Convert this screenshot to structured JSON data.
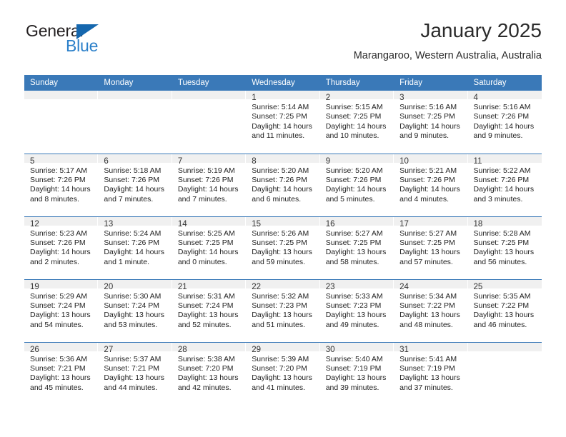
{
  "brand": {
    "name_top": "General",
    "name_bottom": "Blue",
    "accent_color": "#1567ae",
    "text_color": "#231f20"
  },
  "header": {
    "title": "January 2025",
    "location": "Marangaroo, Western Australia, Australia",
    "header_bg_color": "#3a79b8",
    "daynum_bg_color": "#f0f0f0"
  },
  "weekday_headers": [
    "Sunday",
    "Monday",
    "Tuesday",
    "Wednesday",
    "Thursday",
    "Friday",
    "Saturday"
  ],
  "labels": {
    "sunrise": "Sunrise:",
    "sunset": "Sunset:",
    "daylight": "Daylight:"
  },
  "weeks": [
    [
      {
        "day": "",
        "empty": true
      },
      {
        "day": "",
        "empty": true
      },
      {
        "day": "",
        "empty": true
      },
      {
        "day": "1",
        "sunrise": "Sunrise: 5:14 AM",
        "sunset": "Sunset: 7:25 PM",
        "daylight_line1": "Daylight: 14 hours",
        "daylight_line2": "and 11 minutes."
      },
      {
        "day": "2",
        "sunrise": "Sunrise: 5:15 AM",
        "sunset": "Sunset: 7:25 PM",
        "daylight_line1": "Daylight: 14 hours",
        "daylight_line2": "and 10 minutes."
      },
      {
        "day": "3",
        "sunrise": "Sunrise: 5:16 AM",
        "sunset": "Sunset: 7:25 PM",
        "daylight_line1": "Daylight: 14 hours",
        "daylight_line2": "and 9 minutes."
      },
      {
        "day": "4",
        "sunrise": "Sunrise: 5:16 AM",
        "sunset": "Sunset: 7:26 PM",
        "daylight_line1": "Daylight: 14 hours",
        "daylight_line2": "and 9 minutes."
      }
    ],
    [
      {
        "day": "5",
        "sunrise": "Sunrise: 5:17 AM",
        "sunset": "Sunset: 7:26 PM",
        "daylight_line1": "Daylight: 14 hours",
        "daylight_line2": "and 8 minutes."
      },
      {
        "day": "6",
        "sunrise": "Sunrise: 5:18 AM",
        "sunset": "Sunset: 7:26 PM",
        "daylight_line1": "Daylight: 14 hours",
        "daylight_line2": "and 7 minutes."
      },
      {
        "day": "7",
        "sunrise": "Sunrise: 5:19 AM",
        "sunset": "Sunset: 7:26 PM",
        "daylight_line1": "Daylight: 14 hours",
        "daylight_line2": "and 7 minutes."
      },
      {
        "day": "8",
        "sunrise": "Sunrise: 5:20 AM",
        "sunset": "Sunset: 7:26 PM",
        "daylight_line1": "Daylight: 14 hours",
        "daylight_line2": "and 6 minutes."
      },
      {
        "day": "9",
        "sunrise": "Sunrise: 5:20 AM",
        "sunset": "Sunset: 7:26 PM",
        "daylight_line1": "Daylight: 14 hours",
        "daylight_line2": "and 5 minutes."
      },
      {
        "day": "10",
        "sunrise": "Sunrise: 5:21 AM",
        "sunset": "Sunset: 7:26 PM",
        "daylight_line1": "Daylight: 14 hours",
        "daylight_line2": "and 4 minutes."
      },
      {
        "day": "11",
        "sunrise": "Sunrise: 5:22 AM",
        "sunset": "Sunset: 7:26 PM",
        "daylight_line1": "Daylight: 14 hours",
        "daylight_line2": "and 3 minutes."
      }
    ],
    [
      {
        "day": "12",
        "sunrise": "Sunrise: 5:23 AM",
        "sunset": "Sunset: 7:26 PM",
        "daylight_line1": "Daylight: 14 hours",
        "daylight_line2": "and 2 minutes."
      },
      {
        "day": "13",
        "sunrise": "Sunrise: 5:24 AM",
        "sunset": "Sunset: 7:26 PM",
        "daylight_line1": "Daylight: 14 hours",
        "daylight_line2": "and 1 minute."
      },
      {
        "day": "14",
        "sunrise": "Sunrise: 5:25 AM",
        "sunset": "Sunset: 7:25 PM",
        "daylight_line1": "Daylight: 14 hours",
        "daylight_line2": "and 0 minutes."
      },
      {
        "day": "15",
        "sunrise": "Sunrise: 5:26 AM",
        "sunset": "Sunset: 7:25 PM",
        "daylight_line1": "Daylight: 13 hours",
        "daylight_line2": "and 59 minutes."
      },
      {
        "day": "16",
        "sunrise": "Sunrise: 5:27 AM",
        "sunset": "Sunset: 7:25 PM",
        "daylight_line1": "Daylight: 13 hours",
        "daylight_line2": "and 58 minutes."
      },
      {
        "day": "17",
        "sunrise": "Sunrise: 5:27 AM",
        "sunset": "Sunset: 7:25 PM",
        "daylight_line1": "Daylight: 13 hours",
        "daylight_line2": "and 57 minutes."
      },
      {
        "day": "18",
        "sunrise": "Sunrise: 5:28 AM",
        "sunset": "Sunset: 7:25 PM",
        "daylight_line1": "Daylight: 13 hours",
        "daylight_line2": "and 56 minutes."
      }
    ],
    [
      {
        "day": "19",
        "sunrise": "Sunrise: 5:29 AM",
        "sunset": "Sunset: 7:24 PM",
        "daylight_line1": "Daylight: 13 hours",
        "daylight_line2": "and 54 minutes."
      },
      {
        "day": "20",
        "sunrise": "Sunrise: 5:30 AM",
        "sunset": "Sunset: 7:24 PM",
        "daylight_line1": "Daylight: 13 hours",
        "daylight_line2": "and 53 minutes."
      },
      {
        "day": "21",
        "sunrise": "Sunrise: 5:31 AM",
        "sunset": "Sunset: 7:24 PM",
        "daylight_line1": "Daylight: 13 hours",
        "daylight_line2": "and 52 minutes."
      },
      {
        "day": "22",
        "sunrise": "Sunrise: 5:32 AM",
        "sunset": "Sunset: 7:23 PM",
        "daylight_line1": "Daylight: 13 hours",
        "daylight_line2": "and 51 minutes."
      },
      {
        "day": "23",
        "sunrise": "Sunrise: 5:33 AM",
        "sunset": "Sunset: 7:23 PM",
        "daylight_line1": "Daylight: 13 hours",
        "daylight_line2": "and 49 minutes."
      },
      {
        "day": "24",
        "sunrise": "Sunrise: 5:34 AM",
        "sunset": "Sunset: 7:22 PM",
        "daylight_line1": "Daylight: 13 hours",
        "daylight_line2": "and 48 minutes."
      },
      {
        "day": "25",
        "sunrise": "Sunrise: 5:35 AM",
        "sunset": "Sunset: 7:22 PM",
        "daylight_line1": "Daylight: 13 hours",
        "daylight_line2": "and 46 minutes."
      }
    ],
    [
      {
        "day": "26",
        "sunrise": "Sunrise: 5:36 AM",
        "sunset": "Sunset: 7:21 PM",
        "daylight_line1": "Daylight: 13 hours",
        "daylight_line2": "and 45 minutes."
      },
      {
        "day": "27",
        "sunrise": "Sunrise: 5:37 AM",
        "sunset": "Sunset: 7:21 PM",
        "daylight_line1": "Daylight: 13 hours",
        "daylight_line2": "and 44 minutes."
      },
      {
        "day": "28",
        "sunrise": "Sunrise: 5:38 AM",
        "sunset": "Sunset: 7:20 PM",
        "daylight_line1": "Daylight: 13 hours",
        "daylight_line2": "and 42 minutes."
      },
      {
        "day": "29",
        "sunrise": "Sunrise: 5:39 AM",
        "sunset": "Sunset: 7:20 PM",
        "daylight_line1": "Daylight: 13 hours",
        "daylight_line2": "and 41 minutes."
      },
      {
        "day": "30",
        "sunrise": "Sunrise: 5:40 AM",
        "sunset": "Sunset: 7:19 PM",
        "daylight_line1": "Daylight: 13 hours",
        "daylight_line2": "and 39 minutes."
      },
      {
        "day": "31",
        "sunrise": "Sunrise: 5:41 AM",
        "sunset": "Sunset: 7:19 PM",
        "daylight_line1": "Daylight: 13 hours",
        "daylight_line2": "and 37 minutes."
      },
      {
        "day": "",
        "empty": true
      }
    ]
  ]
}
